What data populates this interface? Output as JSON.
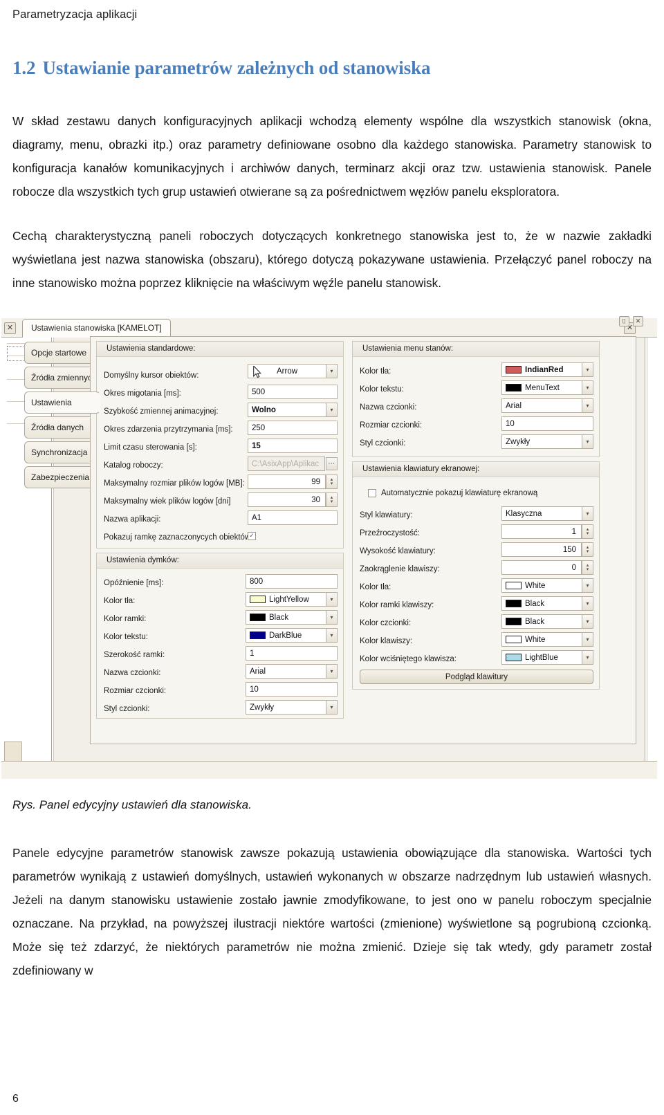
{
  "document": {
    "running_head": "Parametryzacja aplikacji",
    "section_number": "1.2",
    "section_title": "Ustawianie parametrów zależnych od stanowiska",
    "heading_color": "#4a7ebb",
    "paragraph_1": "W skład zestawu danych konfiguracyjnych aplikacji wchodzą elementy wspólne dla wszystkich stanowisk (okna, diagramy, menu, obrazki itp.) oraz parametry definiowane osobno dla każdego stanowiska. Parametry stanowisk to konfiguracja kanałów komunikacyjnych i archiwów danych, terminarz akcji oraz tzw. ustawienia stanowisk. Panele robocze dla wszystkich tych grup ustawień otwierane są za pośrednictwem węzłów panelu eksploratora.",
    "paragraph_2": "Cechą charakterystyczną paneli roboczych dotyczących konkretnego stanowiska jest to, że w nazwie zakładki wyświetlana jest nazwa stanowiska (obszaru), którego dotyczą pokazywane ustawienia. Przełączyć  panel roboczy na inne stanowisko można poprzez kliknięcie na właściwym węźle panelu stanowisk.",
    "figure_caption": "Rys. Panel edycyjny ustawień dla stanowiska.",
    "paragraph_3": "Panele edycyjne parametrów stanowisk zawsze pokazują ustawienia obowiązujące dla stanowiska. Wartości tych parametrów wynikają z ustawień domyślnych, ustawień wykonanych w obszarze nadrzędnym lub ustawień własnych. Jeżeli na danym stanowisku ustawienie zostało jawnie zmodyfikowane, to jest ono w panelu roboczym  specjalnie oznaczane. Na przykład, na powyższej ilustracji niektóre wartości (zmienione) wyświetlone są pogrubioną czcionką. Może się też zdarzyć, że niektórych parametrów nie można zmienić. Dzieje się tak wtedy, gdy parametr został zdefiniowany w",
    "page_number": "6"
  },
  "screenshot": {
    "window_tab_label": "Ustawienia stanowiska  [KAMELOT]",
    "close_icon_glyph": "✕",
    "side_tabs": [
      {
        "label": "Opcje startowe",
        "active": false
      },
      {
        "label": "Źródła zmiennych",
        "active": false
      },
      {
        "label": "Ustawienia",
        "active": true
      },
      {
        "label": "Źródła danych",
        "active": false
      },
      {
        "label": "Synchronizacja",
        "active": false
      },
      {
        "label": "Zabezpieczenia",
        "active": false
      }
    ],
    "groups": {
      "standard": {
        "title": "Ustawienia standardowe:",
        "fields": [
          {
            "label": "Domyślny kursor obiektów:",
            "value": "Arrow",
            "type": "combo",
            "bold": false,
            "icon": "mouse-cursor-icon"
          },
          {
            "label": "Okres migotania [ms]:",
            "value": "500",
            "type": "text",
            "bold": false
          },
          {
            "label": " Szybkość zmiennej animacyjnej:",
            "value": "Wolno",
            "type": "combo",
            "bold": true
          },
          {
            "label": "Okres zdarzenia przytrzymania [ms]:",
            "value": "250",
            "type": "text",
            "bold": false
          },
          {
            "label": "Limit czasu sterowania [s]:",
            "value": "15",
            "type": "text",
            "bold": true
          },
          {
            "label": "Katalog roboczy:",
            "value": "C:\\AsixApp\\Aplikac",
            "type": "path",
            "bold": false,
            "disabled": true
          },
          {
            "label": "Maksymalny rozmiar plików logów [MB]:",
            "value": "99",
            "type": "spin",
            "bold": false
          },
          {
            "label": "Maksymalny wiek plików logów [dni]",
            "value": "30",
            "type": "spin",
            "bold": false
          },
          {
            "label": "Nazwa aplikacji:",
            "value": "A1",
            "type": "text",
            "bold": false
          },
          {
            "label": "Pokazuj ramkę zaznaczonycych obiektów:",
            "value": "",
            "type": "checkbox",
            "checked": true
          }
        ]
      },
      "tooltips": {
        "title": "Ustawienia dymków:",
        "fields": [
          {
            "label": "Opóźnienie [ms]:",
            "value": "800",
            "type": "text"
          },
          {
            "label": "Kolor tła:",
            "value": "LightYellow",
            "type": "color",
            "color": "#fbfbd2"
          },
          {
            "label": "Kolor ramki:",
            "value": "Black",
            "type": "color",
            "color": "#000000"
          },
          {
            "label": "Kolor tekstu:",
            "value": "DarkBlue",
            "type": "color",
            "color": "#00008b"
          },
          {
            "label": "Szerokość ramki:",
            "value": "1",
            "type": "text"
          },
          {
            "label": "Nazwa czcionki:",
            "value": "Arial",
            "type": "combo"
          },
          {
            "label": "Rozmiar czcionki:",
            "value": "10",
            "type": "text"
          },
          {
            "label": "Styl czcionki:",
            "value": "Zwykły",
            "type": "combo"
          }
        ]
      },
      "state_menu": {
        "title": "Ustawienia menu stanów:",
        "fields": [
          {
            "label": "Kolor tła:",
            "value": "IndianRed",
            "type": "color",
            "color": "#cd5c5c",
            "bold": true
          },
          {
            "label": "Kolor tekstu:",
            "value": "MenuText",
            "type": "color",
            "color": "#000000",
            "bold": false
          },
          {
            "label": "Nazwa czcionki:",
            "value": "Arial",
            "type": "combo",
            "bold": false
          },
          {
            "label": "Rozmiar czcionki:",
            "value": "10",
            "type": "text",
            "bold": false
          },
          {
            "label": "Styl czcionki:",
            "value": "Zwykły",
            "type": "combo",
            "bold": false
          }
        ]
      },
      "onscreen_keyboard": {
        "title": "Ustawienia klawiatury ekranowej:",
        "checkbox_label": "Automatycznie pokazuj klawiaturę ekranową",
        "checkbox_checked": false,
        "fields": [
          {
            "label": "Styl klawiatury:",
            "value": "Klasyczna",
            "type": "combo"
          },
          {
            "label": "Przeźroczystość:",
            "value": "1",
            "type": "spin"
          },
          {
            "label": "Wysokość klawiatury:",
            "value": "150",
            "type": "spin"
          },
          {
            "label": "Zaokrąglenie klawiszy:",
            "value": "0",
            "type": "spin"
          },
          {
            "label": "Kolor tła:",
            "value": "White",
            "type": "color",
            "color": "#ffffff"
          },
          {
            "label": "Kolor ramki klawiszy:",
            "value": "Black",
            "type": "color",
            "color": "#000000"
          },
          {
            "label": "Kolor czcionki:",
            "value": "Black",
            "type": "color",
            "color": "#000000"
          },
          {
            "label": "Kolor klawiszy:",
            "value": "White",
            "type": "color",
            "color": "#ffffff"
          },
          {
            "label": "Kolor wciśniętego klawisza:",
            "value": "LightBlue",
            "type": "color",
            "color": "#add8e6"
          }
        ],
        "preview_button": "Podgląd klawitury"
      }
    },
    "statusbar": {
      "pin_glyph": "⌷",
      "close_glyph": "✕"
    }
  }
}
